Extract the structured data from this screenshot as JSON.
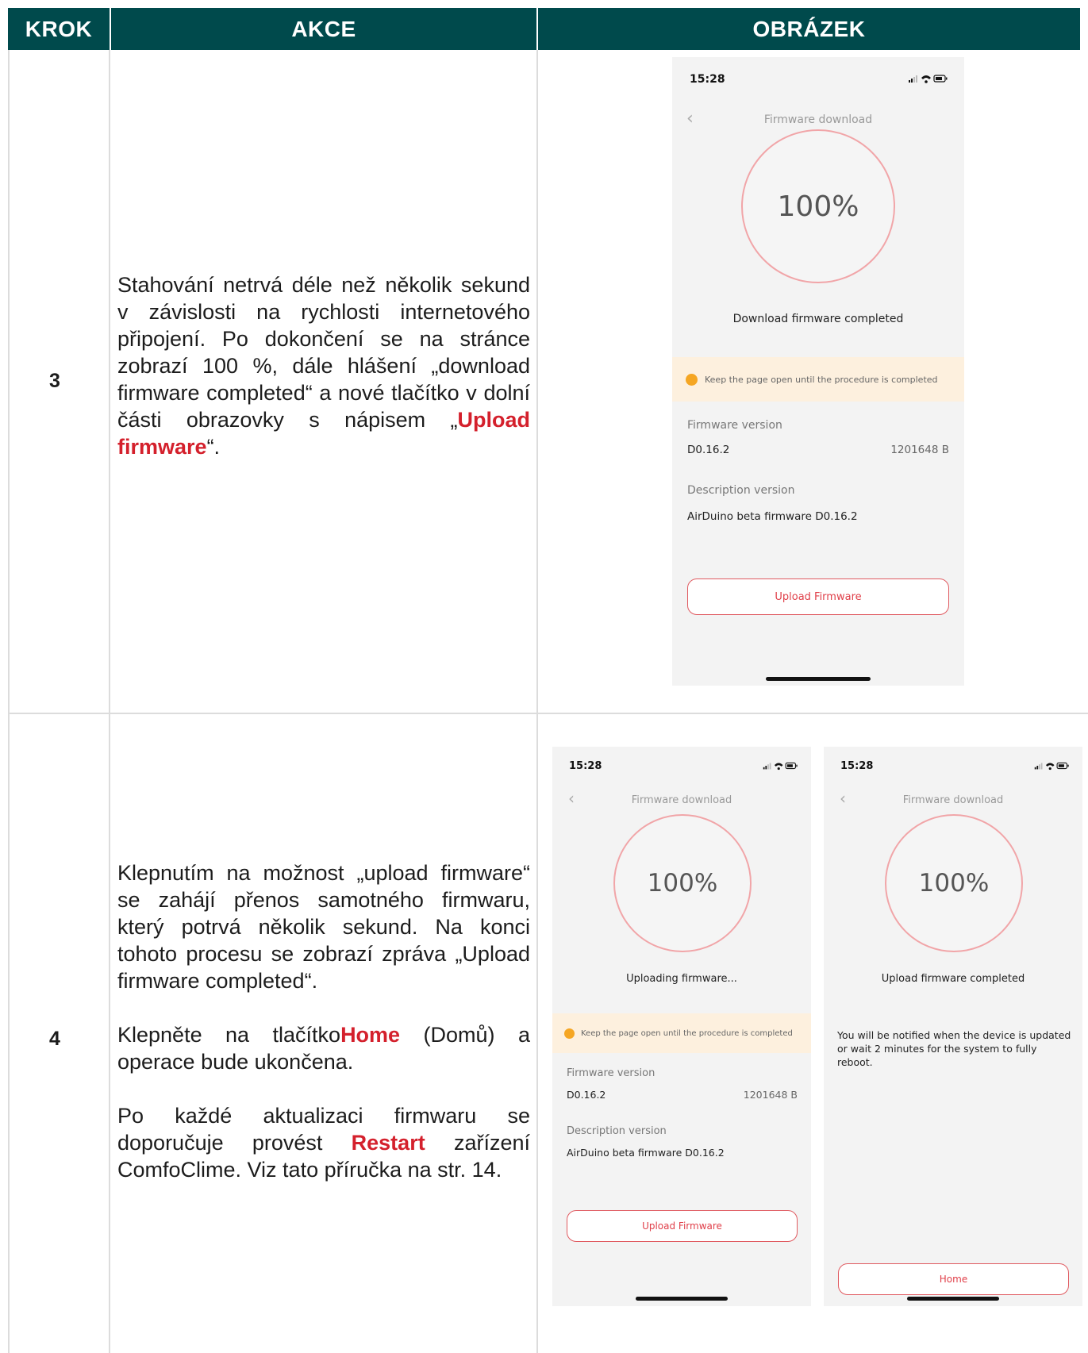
{
  "table": {
    "headers": {
      "step": "KROK",
      "action": "AKCE",
      "image": "OBRÁZEK"
    }
  },
  "rows": [
    {
      "step": "3",
      "text": {
        "main": "Stahování netrvá déle než několik sekund v závislosti na rychlosti internetového připojení. Po dokončení se na stránce zobrazí 100 %, dále hlášení „download firmware completed“ a nové tlačítko v dolní části obrazovky s nápisem „",
        "highlight": "Upload firmware",
        "end": "“."
      }
    },
    {
      "step": "4",
      "text": {
        "p1": "Klepnutím na možnost „upload firmware“ se zahájí přenos samotného firmwaru, který potrvá několik sekund. Na konci tohoto procesu se zobrazí zpráva „Upload firmware completed“.",
        "p2_pre": "Klepněte na tlačítko",
        "p2_highlight": "Home",
        "p2_post": " (Domů) a operace bude ukončena.",
        "p3_pre": "Po každé aktualizaci firmwaru se doporučuje provést ",
        "p3_highlight": "Restart",
        "p3_post": " zařízení ComfoClime. Viz tato příručka na str. 14."
      }
    }
  ],
  "screens": {
    "a": {
      "time": "15:28",
      "title": "Firmware download",
      "percent": "100%",
      "status": "Download firmware completed",
      "warning": "Keep the page open until the procedure is completed",
      "fw_label": "Firmware version",
      "fw_value": "D0.16.2",
      "fw_size": "1201648 B",
      "desc_label": "Description version",
      "desc_value": "AirDuino beta firmware D0.16.2",
      "button": "Upload Firmware"
    },
    "b": {
      "time": "15:28",
      "title": "Firmware download",
      "percent": "100%",
      "status": "Uploading firmware...",
      "warning": "Keep the page open until the procedure is completed",
      "fw_label": "Firmware version",
      "fw_value": "D0.16.2",
      "fw_size": "1201648 B",
      "desc_label": "Description version",
      "desc_value": "AirDuino beta firmware D0.16.2",
      "button": "Upload Firmware"
    },
    "c": {
      "time": "15:28",
      "title": "Firmware download",
      "percent": "100%",
      "status": "Upload firmware completed",
      "notice": "You will be notified when the device is updated or wait 2 minutes for the system to fully reboot.",
      "button": "Home"
    }
  },
  "colors": {
    "header_bg": "#004a4c",
    "highlight": "#d4202c",
    "ring": "#f1a5a8",
    "warning_bg": "#fdf0de",
    "warning_dot": "#f5a623"
  }
}
